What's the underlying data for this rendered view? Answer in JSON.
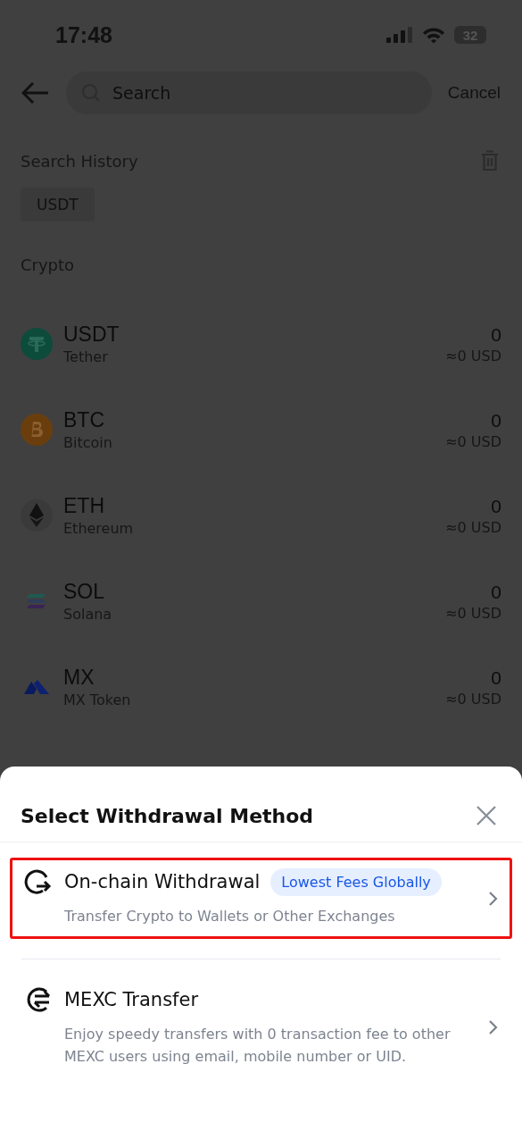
{
  "status_bar": {
    "time": "17:48",
    "battery": "32"
  },
  "search": {
    "placeholder": "Search",
    "cancel": "Cancel"
  },
  "history": {
    "title": "Search History",
    "chips": [
      "USDT"
    ]
  },
  "crypto": {
    "title": "Crypto",
    "coins": [
      {
        "kind": "tether",
        "symbol": "USDT",
        "name": "Tether",
        "amount": "0",
        "value": "≈0 USD"
      },
      {
        "kind": "bitcoin",
        "symbol": "BTC",
        "name": "Bitcoin",
        "amount": "0",
        "value": "≈0 USD"
      },
      {
        "kind": "ethereum",
        "symbol": "ETH",
        "name": "Ethereum",
        "amount": "0",
        "value": "≈0 USD"
      },
      {
        "kind": "solana",
        "symbol": "SOL",
        "name": "Solana",
        "amount": "0",
        "value": "≈0 USD"
      },
      {
        "kind": "mx",
        "symbol": "MX",
        "name": "MX Token",
        "amount": "0",
        "value": "≈0 USD"
      }
    ]
  },
  "sheet": {
    "title": "Select Withdrawal Method",
    "methods": [
      {
        "kind": "onchain",
        "title": "On-chain Withdrawal",
        "badge": "Lowest Fees Globally",
        "description": "Transfer Crypto to Wallets or Other Exchanges",
        "selected": true
      },
      {
        "kind": "transfer",
        "title": "MEXC Transfer",
        "description": "Enjoy speedy transfers with 0 transaction fee to other MEXC users using email, mobile number or UID.",
        "selected": false
      }
    ]
  }
}
